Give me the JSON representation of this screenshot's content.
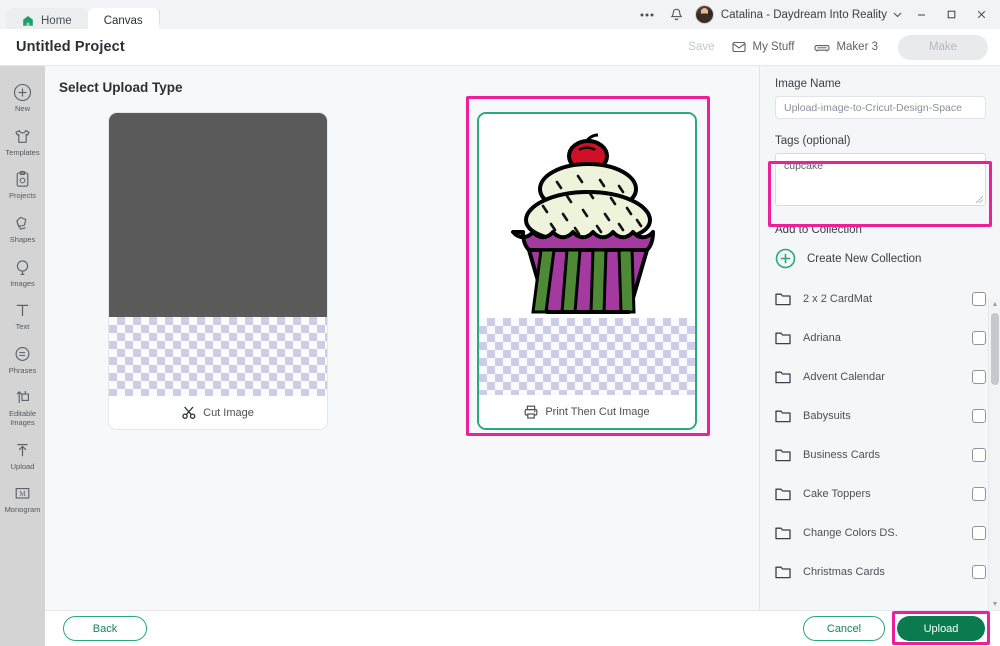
{
  "window": {
    "tabs": [
      {
        "label": "Home",
        "icon": "home-icon",
        "active": false
      },
      {
        "label": "Canvas",
        "icon": "",
        "active": true
      }
    ],
    "overflow_icon": "more-horizontal-icon",
    "notification_icon": "bell-icon",
    "account_name": "Catalina - Daydream Into Reality",
    "account_caret_icon": "chevron-down-icon",
    "minimize_label": "─",
    "maximize_label": "☐",
    "close_label": "✕"
  },
  "project": {
    "title": "Untitled Project",
    "save_label": "Save",
    "my_stuff_label": "My Stuff",
    "my_stuff_icon": "envelope-icon",
    "machine_label": "Maker 3",
    "machine_icon": "cutting-machine-icon",
    "make_label": "Make"
  },
  "rail": {
    "items": [
      {
        "label": "New",
        "icon": "plus-circle-icon"
      },
      {
        "label": "Templates",
        "icon": "tshirt-icon"
      },
      {
        "label": "Projects",
        "icon": "clipboard-icon"
      },
      {
        "label": "Shapes",
        "icon": "shapes-icon"
      },
      {
        "label": "Images",
        "icon": "lightbulb-icon"
      },
      {
        "label": "Text",
        "icon": "text-icon"
      },
      {
        "label": "Phrases",
        "icon": "speech-bubble-icon"
      },
      {
        "label": "Editable Images",
        "icon": "editable-images-icon"
      },
      {
        "label": "Upload",
        "icon": "upload-arrow-icon"
      },
      {
        "label": "Monogram",
        "icon": "monogram-icon"
      }
    ]
  },
  "main": {
    "title": "Select Upload Type",
    "cards": [
      {
        "label": "Cut Image",
        "icon": "scissors-icon",
        "selected": false
      },
      {
        "label": "Print Then Cut Image",
        "icon": "printer-icon",
        "selected": true
      }
    ]
  },
  "panel": {
    "image_name_label": "Image Name",
    "image_name_value": "Upload-image-to-Cricut-Design-Space",
    "tags_label": "Tags (optional)",
    "tags_value": "cupcake",
    "add_to_collection_label": "Add to Collection",
    "create_new_collection_label": "Create New Collection",
    "create_new_collection_icon": "plus-circle-icon",
    "collections": [
      {
        "name": "2 x 2 CardMat",
        "checked": false
      },
      {
        "name": "Adriana",
        "checked": false
      },
      {
        "name": "Advent Calendar",
        "checked": false
      },
      {
        "name": "Babysuits",
        "checked": false
      },
      {
        "name": "Business Cards",
        "checked": false
      },
      {
        "name": "Cake Toppers",
        "checked": false
      },
      {
        "name": "Change Colors DS.",
        "checked": false
      },
      {
        "name": "Christmas Cards",
        "checked": false
      }
    ]
  },
  "bottom": {
    "back_label": "Back",
    "cancel_label": "Cancel",
    "upload_label": "Upload"
  },
  "colors": {
    "brand_green": "#0a7a4f",
    "accent_green": "#2aa87e",
    "highlight_magenta": "#ee1f9b",
    "rail_bg": "#d4d4d4",
    "panel_bg": "#f5f6f8"
  }
}
